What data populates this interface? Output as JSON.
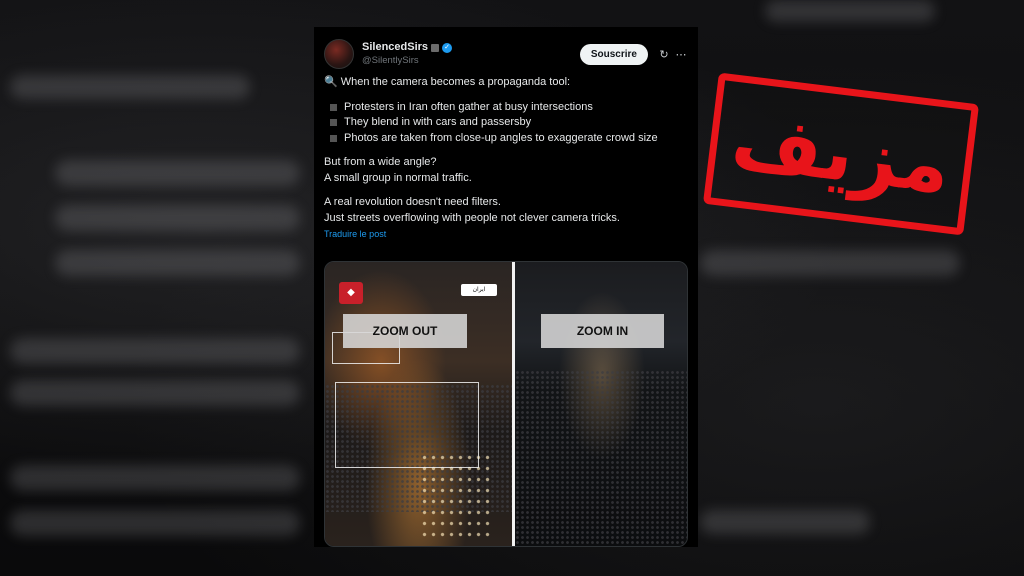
{
  "tweet": {
    "display_name": "SilencedSirs",
    "handle": "@SilentlySirs",
    "subscribe_label": "Souscrire",
    "refresh_icon": "↻",
    "more_icon": "⋯",
    "intro_icon": "🔍",
    "intro": "When the camera becomes a propaganda tool:",
    "bullets": [
      "Protesters in Iran often gather at busy intersections",
      "They blend in with cars and passersby",
      "Photos are taken from close-up angles to exaggerate crowd size"
    ],
    "para2_line1": "But from a wide angle?",
    "para2_line2": "A small group in normal traffic.",
    "para3_line1": "A real revolution doesn't need filters.",
    "para3_line2": "Just streets overflowing with people not clever camera tricks.",
    "translate_label": "Traduire le post"
  },
  "media": {
    "zoom_out_label": "ZOOM OUT",
    "zoom_in_label": "ZOOM IN",
    "location_tag": "ایران"
  },
  "stamp": {
    "text": "مزيف",
    "color": "#e8141a"
  },
  "colors": {
    "link": "#1d9bf0",
    "verified": "#1d9bf0",
    "background": "#000000"
  }
}
